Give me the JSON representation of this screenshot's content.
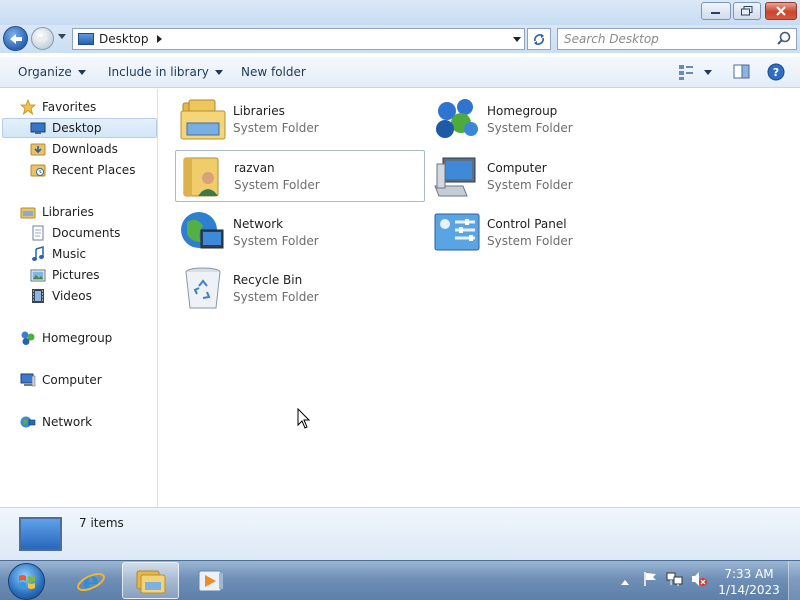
{
  "window": {
    "address": {
      "crumb": "Desktop"
    },
    "search": {
      "placeholder": "Search Desktop"
    }
  },
  "toolbar": {
    "organize": "Organize",
    "include_in_library": "Include in library",
    "new_folder": "New folder"
  },
  "sidebar": {
    "favorites": {
      "label": "Favorites",
      "items": [
        {
          "label": "Desktop",
          "selected": true
        },
        {
          "label": "Downloads"
        },
        {
          "label": "Recent Places"
        }
      ]
    },
    "libraries": {
      "label": "Libraries",
      "items": [
        {
          "label": "Documents"
        },
        {
          "label": "Music"
        },
        {
          "label": "Pictures"
        },
        {
          "label": "Videos"
        }
      ]
    },
    "homegroup": "Homegroup",
    "computer": "Computer",
    "network": "Network"
  },
  "content": {
    "items": [
      {
        "name": "Libraries",
        "type": "System Folder",
        "icon": "libraries-icon"
      },
      {
        "name": "Homegroup",
        "type": "System Folder",
        "icon": "homegroup-icon"
      },
      {
        "name": "razvan",
        "type": "System Folder",
        "icon": "user-folder-icon"
      },
      {
        "name": "Computer",
        "type": "System Folder",
        "icon": "computer-icon"
      },
      {
        "name": "Network",
        "type": "System Folder",
        "icon": "network-icon"
      },
      {
        "name": "Control Panel",
        "type": "System Folder",
        "icon": "control-panel-icon"
      },
      {
        "name": "Recycle Bin",
        "type": "System Folder",
        "icon": "recycle-bin-icon"
      }
    ]
  },
  "details": {
    "count": "7 items"
  },
  "taskbar": {
    "time": "7:33 AM",
    "date": "1/14/2023"
  },
  "colors": {
    "accent": "#2a65b3",
    "toolbar_text": "#1e395b",
    "secondary_text": "#6d6d6d",
    "taskbar": "#6f8fb6"
  }
}
